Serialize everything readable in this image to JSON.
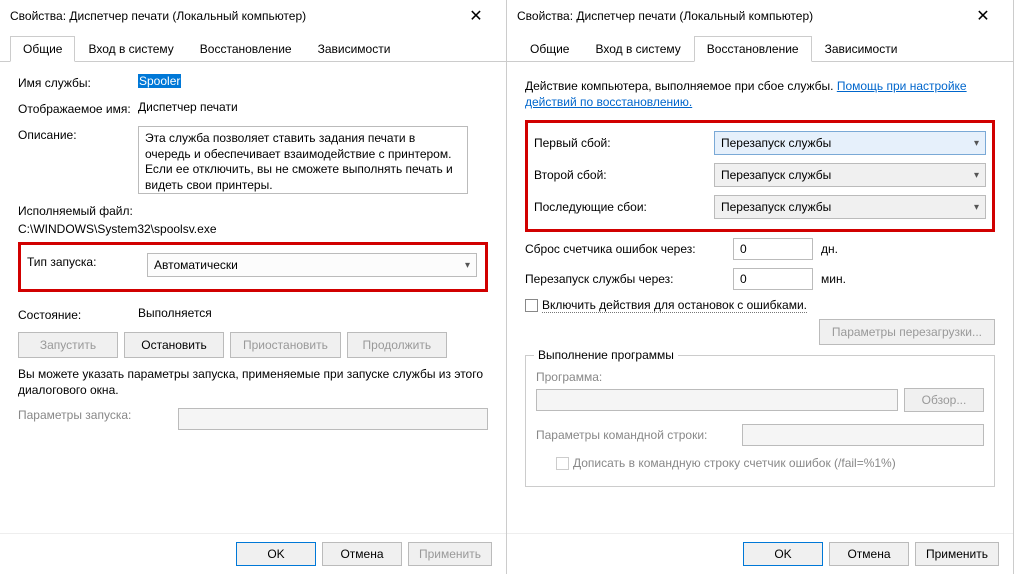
{
  "leftDialog": {
    "title": "Свойства: Диспетчер печати (Локальный компьютер)",
    "tabs": {
      "general": "Общие",
      "logon": "Вход в систему",
      "recovery": "Восстановление",
      "dependencies": "Зависимости"
    },
    "general": {
      "serviceNameLabel": "Имя службы:",
      "serviceName": "Spooler",
      "displayNameLabel": "Отображаемое имя:",
      "displayName": "Диспетчер печати",
      "descriptionLabel": "Описание:",
      "description": "Эта служба позволяет ставить задания печати в очередь и обеспечивает взаимодействие с принтером. Если ее отключить, вы не сможете выполнять печать и видеть свои принтеры.",
      "exeLabel": "Исполняемый файл:",
      "exePath": "C:\\WINDOWS\\System32\\spoolsv.exe",
      "startupTypeLabel": "Тип запуска:",
      "startupType": "Автоматически",
      "statusLabel": "Состояние:",
      "status": "Выполняется",
      "btnStart": "Запустить",
      "btnStop": "Остановить",
      "btnPause": "Приостановить",
      "btnResume": "Продолжить",
      "startParamsHint": "Вы можете указать параметры запуска, применяемые при запуске службы из этого диалогового окна.",
      "startParamsLabel": "Параметры запуска:"
    }
  },
  "rightDialog": {
    "title": "Свойства: Диспетчер печати (Локальный компьютер)",
    "tabs": {
      "general": "Общие",
      "logon": "Вход в систему",
      "recovery": "Восстановление",
      "dependencies": "Зависимости"
    },
    "recovery": {
      "intro": "Действие компьютера, выполняемое при сбое службы.",
      "helpLink": "Помощь при настройке действий по восстановлению.",
      "firstFailureLabel": "Первый сбой:",
      "firstFailure": "Перезапуск службы",
      "secondFailureLabel": "Второй сбой:",
      "secondFailure": "Перезапуск службы",
      "subsequentLabel": "Последующие сбои:",
      "subsequent": "Перезапуск службы",
      "resetCounterLabel": "Сброс счетчика ошибок через:",
      "resetCounterValue": "0",
      "resetCounterUnit": "дн.",
      "restartAfterLabel": "Перезапуск службы через:",
      "restartAfterValue": "0",
      "restartAfterUnit": "мин.",
      "enableActionsLabel": "Включить действия для остановок с ошибками.",
      "restartOptionsBtn": "Параметры перезагрузки...",
      "groupTitle": "Выполнение программы",
      "programLabel": "Программа:",
      "browseBtn": "Обзор...",
      "cmdParamsLabel": "Параметры командной строки:",
      "appendFailLabel": "Дописать в командную строку счетчик ошибок (/fail=%1%)"
    }
  },
  "footer": {
    "ok": "OK",
    "cancel": "Отмена",
    "apply": "Применить"
  }
}
